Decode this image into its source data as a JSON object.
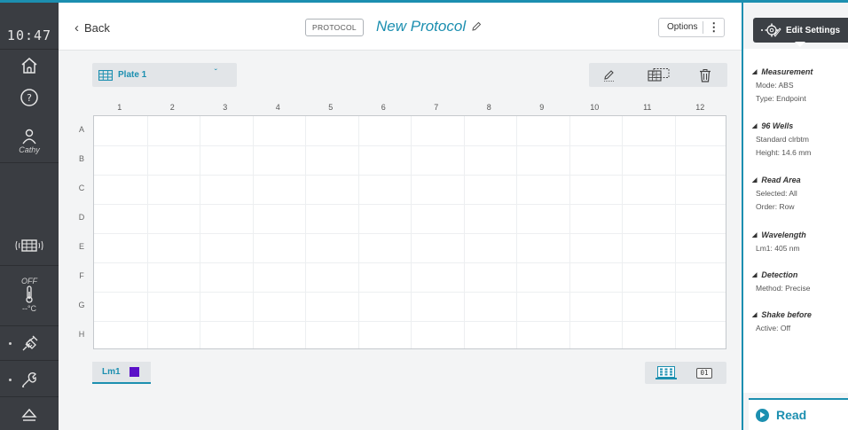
{
  "status": {
    "clock": "10:47"
  },
  "rail": {
    "user_label": "Cathy",
    "temp_state": "OFF",
    "temp_unit": "--°C"
  },
  "header": {
    "back_label": "Back",
    "tag_label": "PROTOCOL",
    "title": "New Protocol",
    "options_label": "Options"
  },
  "plate": {
    "select_label": "Plate 1",
    "columns": [
      "1",
      "2",
      "3",
      "4",
      "5",
      "6",
      "7",
      "8",
      "9",
      "10",
      "11",
      "12"
    ],
    "rows": [
      "A",
      "B",
      "C",
      "D",
      "E",
      "F",
      "G",
      "H"
    ]
  },
  "footer": {
    "wavelength_tab": "Lm1",
    "swatch_color": "#5a10c8",
    "view_numeric_label": "01"
  },
  "panel": {
    "edit_label": "Edit Settings",
    "measurement": {
      "title": "Measurement",
      "mode": "Mode: ABS",
      "type": "Type: Endpoint"
    },
    "wells": {
      "title": "96 Wells",
      "plate": "Standard clrbtm",
      "height": "Height: 14.6 mm"
    },
    "read_area": {
      "title": "Read Area",
      "selected": "Selected: All",
      "order": "Order: Row"
    },
    "wavelength": {
      "title": "Wavelength",
      "lm1": "Lm1: 405 nm"
    },
    "detection": {
      "title": "Detection",
      "method": "Method: Precise"
    },
    "shake": {
      "title": "Shake before",
      "active": "Active: Off"
    },
    "read_label": "Read"
  },
  "colors": {
    "accent": "#1c8fb0",
    "rail": "#3a3d42"
  }
}
